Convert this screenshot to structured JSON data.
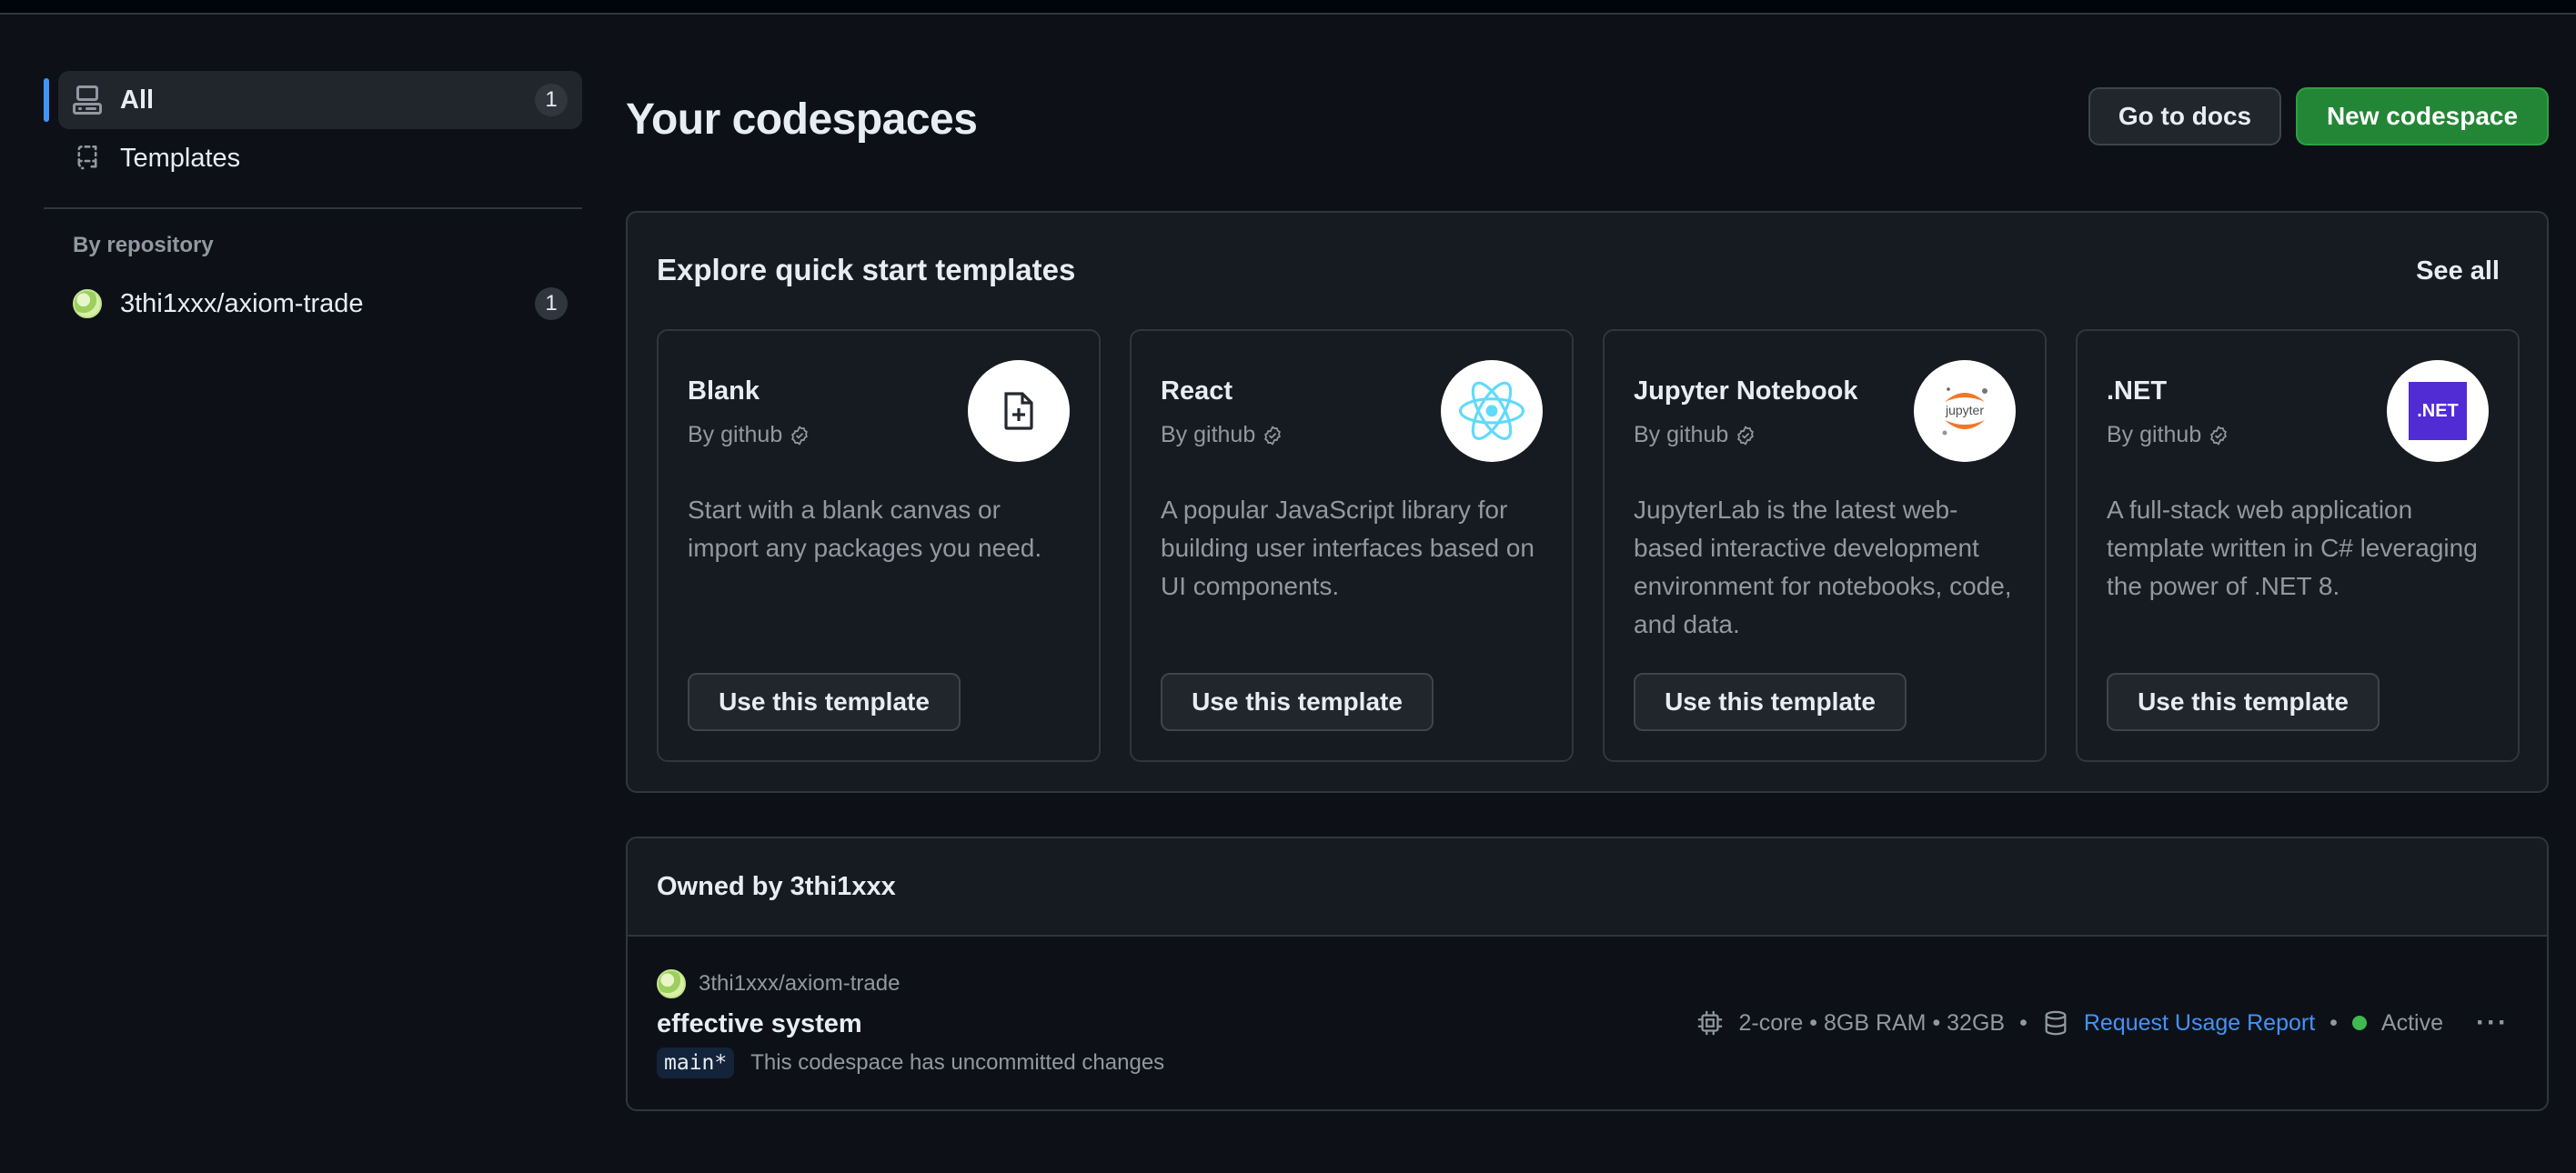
{
  "sidebar": {
    "items": [
      {
        "label": "All",
        "count": "1",
        "icon": "codespaces-icon"
      },
      {
        "label": "Templates",
        "icon": "template-icon"
      }
    ],
    "section_heading": "By repository",
    "repos": [
      {
        "label": "3thi1xxx/axiom-trade",
        "count": "1"
      }
    ]
  },
  "header": {
    "title": "Your codespaces",
    "docs_button": "Go to docs",
    "new_button": "New codespace"
  },
  "templates": {
    "title": "Explore quick start templates",
    "see_all": "See all",
    "cards": [
      {
        "name": "Blank",
        "by": "By github",
        "desc": "Start with a blank canvas or import any packages you need.",
        "button": "Use this template",
        "icon": "new-file-icon"
      },
      {
        "name": "React",
        "by": "By github",
        "desc": "A popular JavaScript library for building user interfaces based on UI components.",
        "button": "Use this template",
        "icon": "react-logo-icon"
      },
      {
        "name": "Jupyter Notebook",
        "by": "By github",
        "desc": "JupyterLab is the latest web-based interactive development environment for notebooks, code, and data.",
        "button": "Use this template",
        "icon": "jupyter-logo-icon",
        "logo_text": "jupyter"
      },
      {
        "name": ".NET",
        "by": "By github",
        "desc": "A full-stack web application template written in C# leveraging the power of .NET 8.",
        "button": "Use this template",
        "icon": "dotnet-logo-icon",
        "logo_text": ".NET"
      }
    ]
  },
  "owned": {
    "title": "Owned by 3thi1xxx",
    "codespace": {
      "repo": "3thi1xxx/axiom-trade",
      "name": "effective system",
      "branch": "main*",
      "note": "This codespace has uncommitted changes",
      "specs": "2-core • 8GB RAM • 32GB",
      "usage_link": "Request Usage Report",
      "status": "Active",
      "more": "···"
    }
  },
  "colors": {
    "background": "#0d1117",
    "accent_blue": "#4493f8",
    "primary_green": "#238636",
    "status_active": "#3fb950",
    "react_blue": "#61dafb",
    "jupyter_orange": "#f37726",
    "dotnet_purple": "#512bd4"
  }
}
